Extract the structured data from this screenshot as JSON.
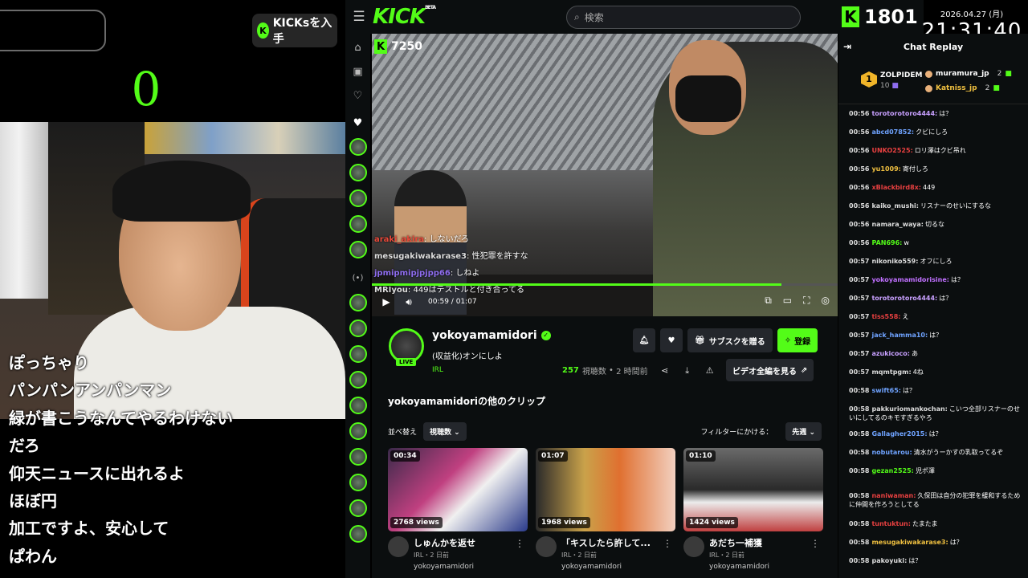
{
  "overlay": {
    "kicks_button": "KICKsを入手",
    "counter": "0",
    "comments": [
      "ぽっちゃり",
      "パンパンアンパンマン",
      "緑が書こうなんてやるわけない",
      "だろ",
      "仰天ニュースに出れるよ",
      "ほぼ円",
      "加工ですよ、安心して",
      "ぱわん"
    ]
  },
  "topbar": {
    "logo": "KICK",
    "beta": "BETA",
    "search_placeholder": "検索"
  },
  "video": {
    "viewer_badge": "7250",
    "current_time": "00:59",
    "duration": "01:07",
    "progress": 0.88,
    "overlay_chat": [
      {
        "user": "araki_akira",
        "text": "しないだろ",
        "color": "#e8493a"
      },
      {
        "user": "mesugakiwakarase3",
        "text": "性犯罪を許すな",
        "color": "#dddddd"
      },
      {
        "user": "jpmipmipjpjpp66",
        "text": "しねよ",
        "color": "#8f6df0"
      },
      {
        "user": "MRIyou",
        "text": "449はテストルと付き合ってる",
        "color": "#dddddd"
      }
    ]
  },
  "channel": {
    "name": "yokoyamamidori",
    "live": "LIVE",
    "title": "(収益化)オンにしよ",
    "category": "IRL",
    "viewers": "257",
    "viewers_label": "視聴数",
    "elapsed": "2 時間前",
    "gift_sub": "サブスクを贈る",
    "follow": "登録",
    "watch_vod": "ビデオ全編を見る"
  },
  "clips": {
    "heading": "yokoyamamidoriの他のクリップ",
    "sort_label": "並べ替え",
    "sort_value": "視聴数",
    "filter_label": "フィルターにかける：",
    "filter_value": "先週",
    "items": [
      {
        "duration": "00:34",
        "views": "2768 views",
        "title": "しゅんかを返せ",
        "meta": "IRL・2 日前",
        "user": "yokoyamamidori"
      },
      {
        "duration": "01:07",
        "views": "1968 views",
        "title": "「キスしたら許して...",
        "meta": "IRL・2 日前",
        "user": "yokoyamamidori"
      },
      {
        "duration": "01:10",
        "views": "1424 views",
        "title": "あだち一補獲",
        "meta": "IRL・2 日前",
        "user": "yokoyamamidori"
      }
    ]
  },
  "stream_overlay": {
    "kick_count": "1801",
    "date": "2026.04.27 (月)",
    "time": "21:31:40"
  },
  "chat": {
    "title": "Chat Replay",
    "leaderboard": {
      "rank": "1",
      "top_user": "ZOLPIDEM",
      "top_count": "10",
      "u2": "muramura_jp",
      "u2_count": "2",
      "u3": "Katniss_jp",
      "u3_count": "2"
    },
    "messages": [
      {
        "time": "00:56",
        "user": "torotorotoro4444:",
        "text": "は？",
        "color": "#c8a0ff"
      },
      {
        "time": "00:56",
        "user": "abcd07852:",
        "text": "クビにしろ",
        "color": "#6fa3ff"
      },
      {
        "time": "00:56",
        "user": "UNKO2525:",
        "text": "ロリ澤はクビ吊れ",
        "color": "#e84040"
      },
      {
        "time": "00:56",
        "user": "yu1009:",
        "text": "寄付しろ",
        "color": "#f0c040"
      },
      {
        "time": "00:56",
        "user": "xBlackbird8x:",
        "text": "449",
        "color": "#e84040"
      },
      {
        "time": "00:56",
        "user": "kaiko_mushi:",
        "text": "リスナーのせいにするな",
        "color": "#dddddd"
      },
      {
        "time": "00:56",
        "user": "namara_waya:",
        "text": "切るな",
        "color": "#dddddd"
      },
      {
        "time": "00:56",
        "user": "PAN696:",
        "text": "w",
        "color": "#53fc18"
      },
      {
        "time": "00:57",
        "user": "nikoniko559:",
        "text": "オフにしろ",
        "color": "#dddddd"
      },
      {
        "time": "00:57",
        "user": "yokoyamamidorisine:",
        "text": "は？",
        "color": "#c070ff"
      },
      {
        "time": "00:57",
        "user": "torotorotoro4444:",
        "text": "は？",
        "color": "#c8a0ff"
      },
      {
        "time": "00:57",
        "user": "tiss558:",
        "text": "え",
        "color": "#e84040"
      },
      {
        "time": "00:57",
        "user": "jack_hamma10:",
        "text": "は？",
        "color": "#6fa3ff"
      },
      {
        "time": "00:57",
        "user": "azukicoco:",
        "text": "あ",
        "color": "#c8a0ff"
      },
      {
        "time": "00:57",
        "user": "mqmtpgm:",
        "text": "4ね",
        "color": "#dddddd"
      },
      {
        "time": "00:58",
        "user": "swift65:",
        "text": "は？",
        "color": "#6fa3ff"
      },
      {
        "time": "00:58",
        "user": "pakkuriomankochan:",
        "text": "こいつ全部リスナーのせいにしてるのキモすぎるやろ",
        "color": "#dddddd"
      },
      {
        "time": "00:58",
        "user": "Gallagher2015:",
        "text": "は？",
        "color": "#6fa3ff"
      },
      {
        "time": "00:58",
        "user": "nobutarou:",
        "text": "清水がうーかすの乳取ってるぞ",
        "color": "#6fa3ff"
      },
      {
        "time": "00:58",
        "user": "gezan2525:",
        "text": "児ポ澤",
        "color": "#53fc18"
      },
      {
        "time": "00:58",
        "user": "naniwaman:",
        "text": "久保田は自分の犯罪を緩和するために仲間を作ろうとしてる",
        "color": "#e84040"
      },
      {
        "time": "00:58",
        "user": "tuntuktun:",
        "text": "たまたま",
        "color": "#e84040"
      },
      {
        "time": "00:58",
        "user": "mesugakiwakarase3:",
        "text": "は？",
        "color": "#f0c040"
      },
      {
        "time": "00:58",
        "user": "pakoyuki:",
        "text": "は？",
        "color": "#dddddd"
      }
    ]
  }
}
